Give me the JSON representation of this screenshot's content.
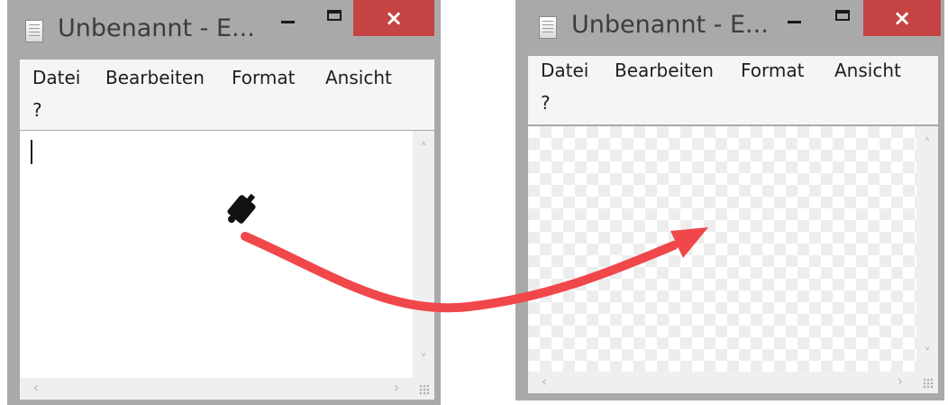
{
  "windows": [
    {
      "title": "Unbenannt - E...",
      "menu": [
        "Datei",
        "Bearbeiten",
        "Format",
        "Ansicht",
        "?"
      ],
      "background": "opaque"
    },
    {
      "title": "Unbenannt - E...",
      "menu": [
        "Datei",
        "Bearbeiten",
        "Format",
        "Ansicht",
        "?"
      ],
      "background": "transparent"
    }
  ],
  "controls": {
    "minimize": "minimize-icon",
    "maximize": "maximize-icon",
    "close": "×"
  },
  "scroll_glyphs": {
    "up": "˄",
    "down": "˅",
    "left": "‹",
    "right": "›"
  },
  "annotation": {
    "paint_bucket_icon": "paint-bucket-icon",
    "arrow_color": "#f0474b"
  },
  "colors": {
    "window_frame": "#a9a9a9",
    "close_button": "#c64343",
    "menubar": "#f5f5f5",
    "checker": "#ededed"
  }
}
